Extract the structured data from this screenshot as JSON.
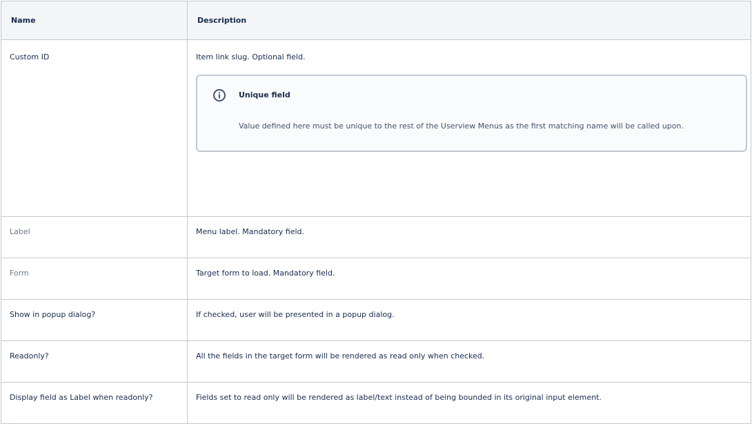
{
  "table": {
    "headers": {
      "name": "Name",
      "description": "Description"
    },
    "rows": [
      {
        "name": "Custom ID",
        "description": "Item link slug. Optional field.",
        "panel": {
          "icon": "info-icon",
          "title": "Unique field",
          "body": "Value defined here must be unique to the rest of the Userview Menus as the first matching name will be called upon."
        }
      },
      {
        "name": "Label",
        "description": "Menu label. Mandatory field."
      },
      {
        "name": "Form",
        "description": "Target form to load. Mandatory field."
      },
      {
        "name": "Show in popup dialog?",
        "description": "If checked, user will be presented in a popup dialog."
      },
      {
        "name": "Readonly?",
        "description": "All the fields in the target form will be rendered as read only when checked."
      },
      {
        "name": "Display field as Label when readonly?",
        "description": "Fields set to read only will be rendered as label/text instead of being bounded in its original input element."
      }
    ]
  },
  "colors": {
    "header_bg": "#f4f5f7",
    "border": "#c1c7d0",
    "panel_bg": "#fafbfc",
    "muted_text": "#6b778c"
  }
}
